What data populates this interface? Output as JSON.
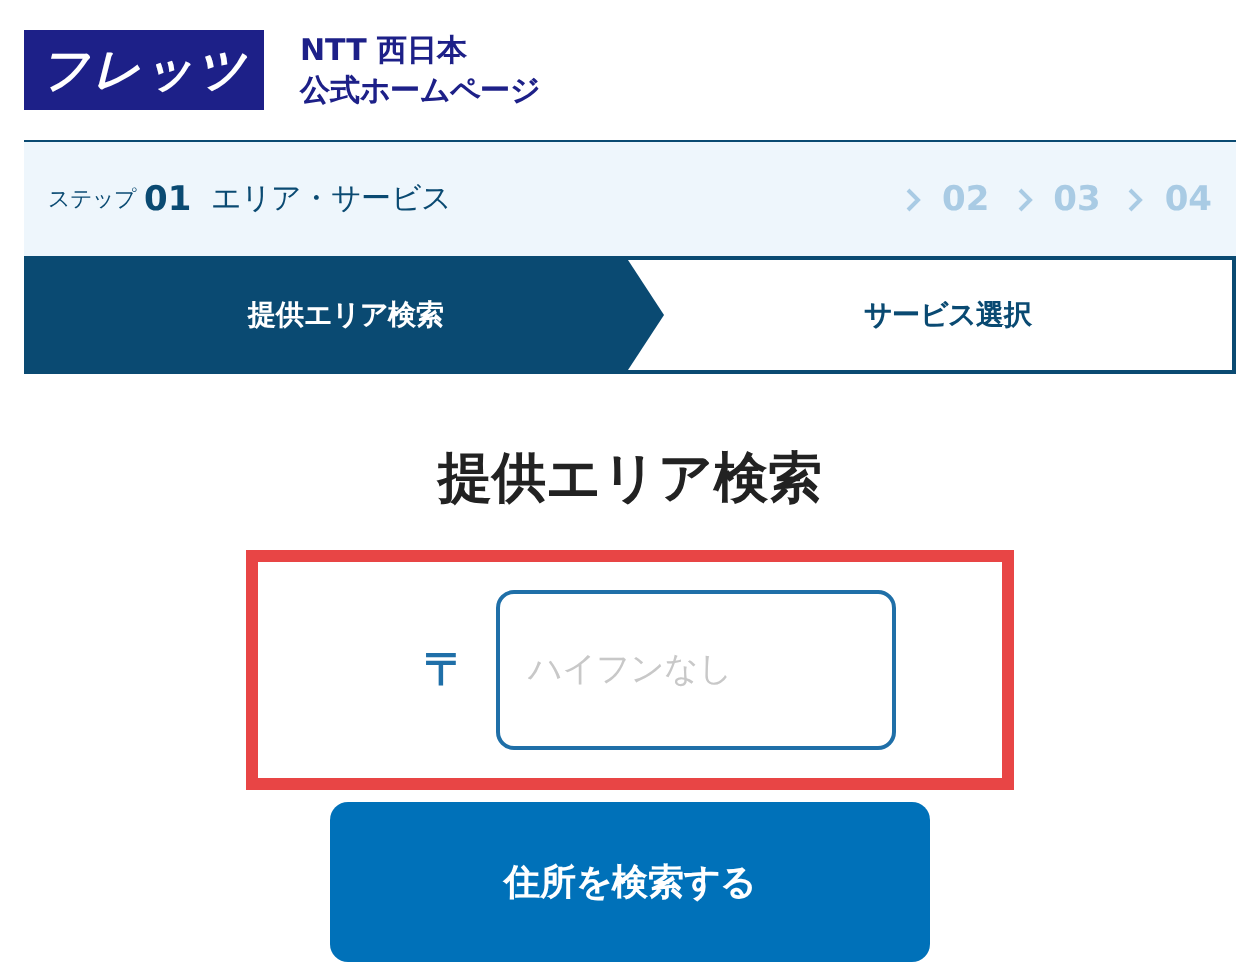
{
  "header": {
    "logo": "フレッツ",
    "company": "NTT 西日本",
    "site": "公式ホームページ"
  },
  "steps": {
    "prefix": "ステップ",
    "current": "01",
    "current_name": "エリア・サービス",
    "next": [
      "02",
      "03",
      "04"
    ]
  },
  "tabs": [
    {
      "label": "提供エリア検索",
      "selected": true
    },
    {
      "label": "サービス選択",
      "selected": false
    }
  ],
  "heading": "提供エリア検索",
  "postal": {
    "symbol": "〒",
    "placeholder": "ハイフンなし",
    "highlighted": true
  },
  "search_button": "住所を検索する"
}
